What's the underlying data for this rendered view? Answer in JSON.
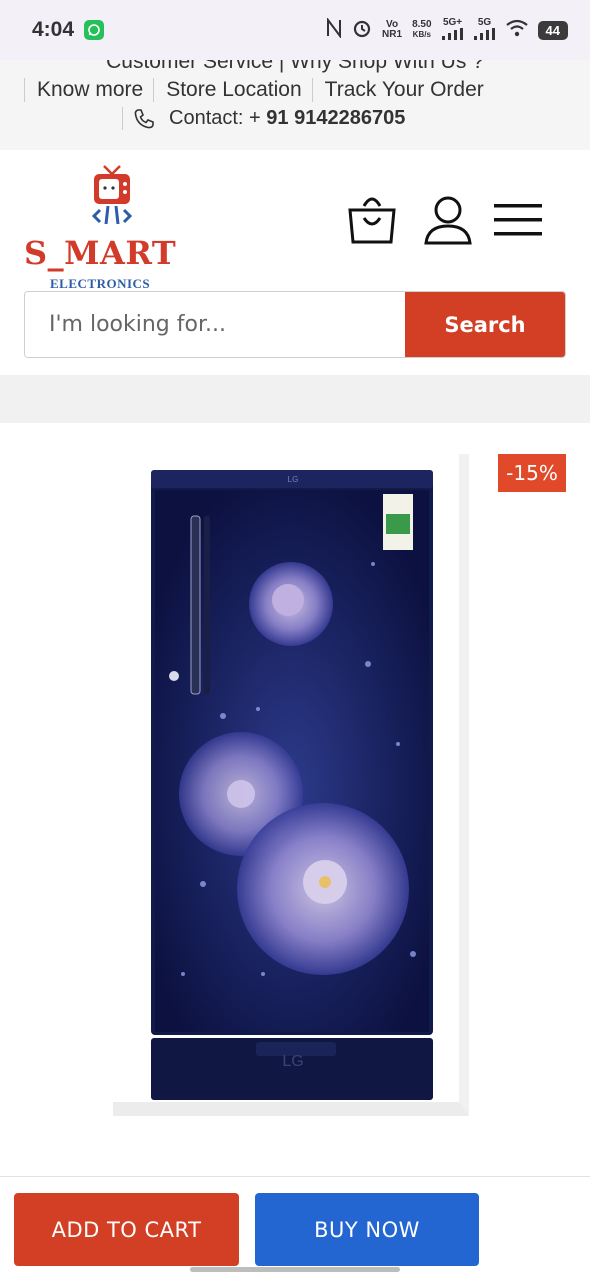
{
  "status_bar": {
    "time": "4:04",
    "vo": "Vo",
    "nr1": "NR1",
    "speed": "8.50",
    "speed_unit": "KB/s",
    "net1": "5G+",
    "net2": "5G",
    "battery": "44"
  },
  "top_links": {
    "row1": "Customer Service  |  Why Shop With Us ?",
    "know_more": "Know more",
    "store_location": "Store Location",
    "track_order": "Track Your Order",
    "contact_label": "Contact: + ",
    "contact_number": "91 9142286705"
  },
  "logo": {
    "name": "S_MART",
    "sub": "ELECTRONICS"
  },
  "search": {
    "placeholder": "I'm looking for...",
    "button": "Search"
  },
  "product": {
    "discount_badge": "-15%",
    "brand_mark": "LG"
  },
  "actions": {
    "add_to_cart": "ADD TO CART",
    "buy_now": "BUY NOW"
  },
  "colors": {
    "accent_red": "#d23f25",
    "buy_blue": "#2466d1"
  }
}
